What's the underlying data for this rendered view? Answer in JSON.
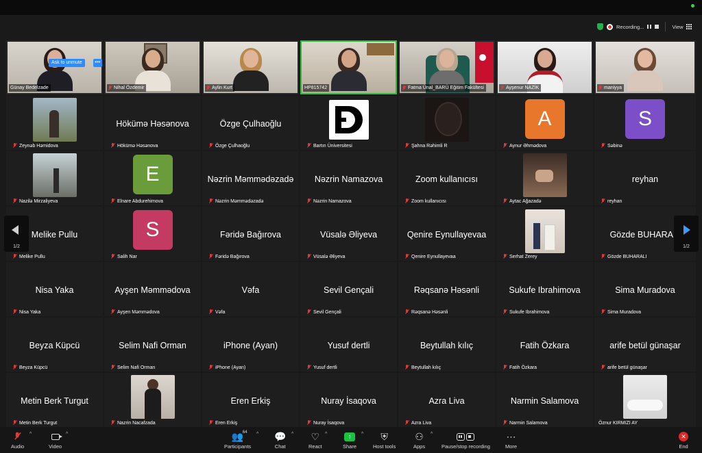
{
  "topbar": {
    "recording_label": "Recording...",
    "view_label": "View"
  },
  "video_row": [
    {
      "name": "Günay Bedelzade",
      "muted": false
    },
    {
      "name": "Nihal Özdemir",
      "muted": true
    },
    {
      "name": "Aylin Kurt",
      "muted": true
    },
    {
      "name": "HP815742",
      "muted": false,
      "active_speaker": true
    },
    {
      "name": "Fatma Ünal_BARÜ Eğitim Fakültesi",
      "muted": true
    },
    {
      "name": "Ayşenur NAZİK",
      "muted": true
    },
    {
      "name": "maniyya",
      "muted": true
    }
  ],
  "grid": [
    [
      {
        "name": "Zeynəb Həmidova",
        "kind": "thumb"
      },
      {
        "name": "Hökümə Həsənova",
        "kind": "text"
      },
      {
        "name": "Özge Çulhaoğlu",
        "kind": "text"
      },
      {
        "name": "Bartın Üniversitesi",
        "kind": "logo"
      },
      {
        "name": "Şahna Rəhimli R",
        "kind": "thumb"
      },
      {
        "name": "Aynur Əhmədova",
        "kind": "avatar",
        "letter": "A",
        "color": "#e8772b"
      },
      {
        "name": "Səbinə",
        "kind": "avatar",
        "letter": "S",
        "color": "#7c4fc9"
      }
    ],
    [
      {
        "name": "Nazilə Mirzaliyeva",
        "kind": "thumb"
      },
      {
        "name": "Elnare Abdurehimova",
        "kind": "avatar",
        "letter": "E",
        "color": "#6a9c3c"
      },
      {
        "name": "Nəzrin Məmmədəzadə",
        "kind": "text"
      },
      {
        "name": "Nəzrin Namazova",
        "kind": "text"
      },
      {
        "name": "Zoom kullanıcısı",
        "kind": "text"
      },
      {
        "name": "Aytac Ağazadə",
        "kind": "thumb"
      },
      {
        "name": "reyhan",
        "kind": "text"
      }
    ],
    [
      {
        "name": "Melike Pullu",
        "kind": "text"
      },
      {
        "name": "Salih Nar",
        "kind": "avatar",
        "letter": "S",
        "color": "#c43a63"
      },
      {
        "name": "Fəridə Bağırova",
        "kind": "text"
      },
      {
        "name": "Vüsalə Əliyeva",
        "kind": "text"
      },
      {
        "name": "Qenire Eynullayevaa",
        "kind": "text"
      },
      {
        "name": "Serhat Zerey",
        "kind": "thumb"
      },
      {
        "name": "Gözde BUHARALI",
        "kind": "text"
      }
    ],
    [
      {
        "name": "Nisa Yaka",
        "kind": "text"
      },
      {
        "name": "Ayşen Məmmədova",
        "kind": "text"
      },
      {
        "name": "Vəfa",
        "kind": "text"
      },
      {
        "name": "Sevil Gençali",
        "kind": "text"
      },
      {
        "name": "Rəqsanə Həsənli",
        "kind": "text"
      },
      {
        "name": "Sukufe Ibrahimova",
        "kind": "text"
      },
      {
        "name": "Sima Muradova",
        "kind": "text"
      }
    ],
    [
      {
        "name": "Beyza Küpcü",
        "kind": "text"
      },
      {
        "name": "Selim Nafi Orman",
        "kind": "text"
      },
      {
        "name": "iPhone (Ayan)",
        "kind": "text"
      },
      {
        "name": "Yusuf dertli",
        "kind": "text"
      },
      {
        "name": "Beytullah kılıç",
        "kind": "text"
      },
      {
        "name": "Fatih Özkara",
        "kind": "text"
      },
      {
        "name": "arife betül günaşar",
        "kind": "text"
      }
    ],
    [
      {
        "name": "Metin Berk Turgut",
        "kind": "text"
      },
      {
        "name": "Nazrin Nacafzada",
        "kind": "thumb"
      },
      {
        "name": "Eren Erkiş",
        "kind": "text"
      },
      {
        "name": "Nuray İsaqova",
        "kind": "text"
      },
      {
        "name": "Azra Liva",
        "kind": "text"
      },
      {
        "name": "Narmin Salamova",
        "kind": "text"
      },
      {
        "name": "Öznur KIRMIZI AY",
        "kind": "thumb"
      }
    ]
  ],
  "tooltip": {
    "ask_to_unmute": "Ask to unmute",
    "more": "•••"
  },
  "pagination": {
    "prev_page": "1/2",
    "next_page": "1/2"
  },
  "toolbar": {
    "audio": "Audio",
    "video": "Video",
    "participants": "Participants",
    "participants_count": "64",
    "chat": "Chat",
    "react": "React",
    "share": "Share",
    "host_tools": "Host tools",
    "apps": "Apps",
    "pause_stop_recording": "Pause/stop recording",
    "more": "More",
    "end": "End"
  }
}
